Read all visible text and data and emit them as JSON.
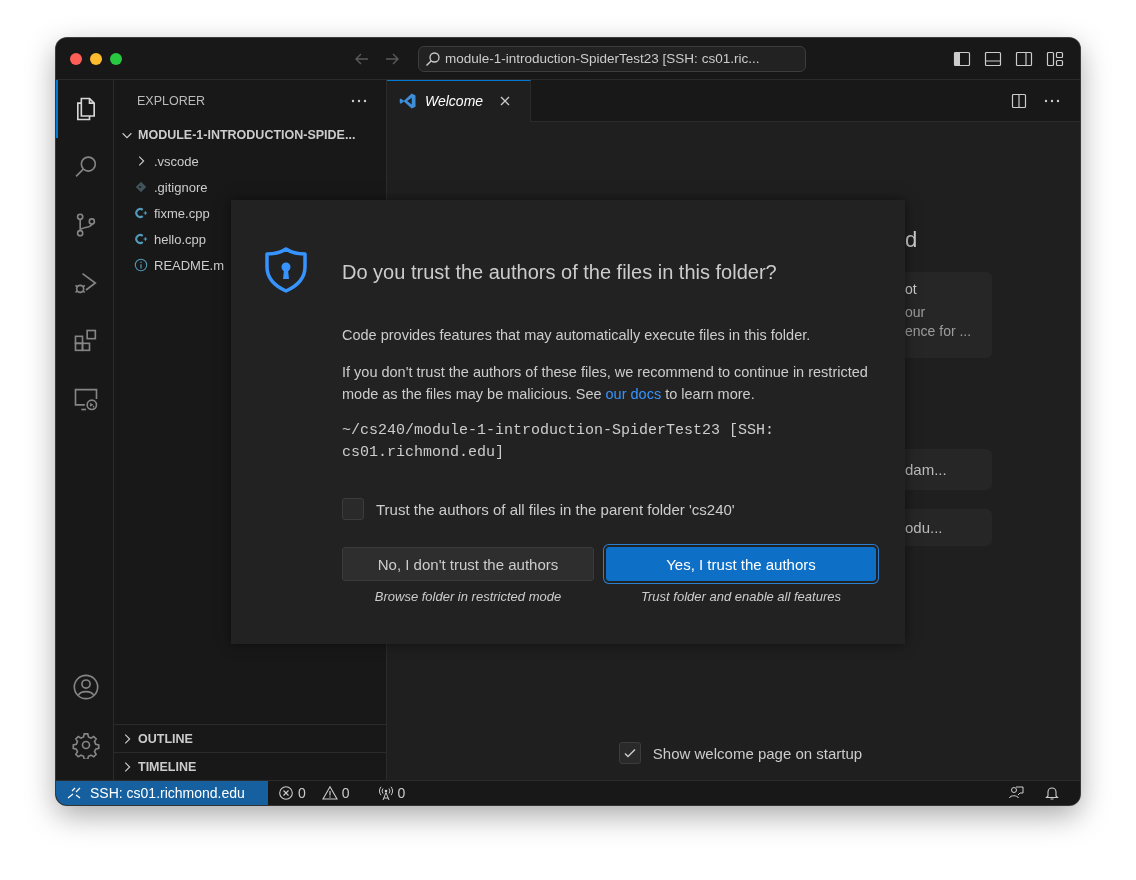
{
  "title_bar": {
    "command_center": "module-1-introduction-SpiderTest23 [SSH: cs01.ric..."
  },
  "activity_bar": {
    "items": [
      {
        "kind": "explorer",
        "selected": true
      },
      {
        "kind": "search",
        "selected": false
      },
      {
        "kind": "source-control",
        "selected": false
      },
      {
        "kind": "run-debug",
        "selected": false
      },
      {
        "kind": "extensions",
        "selected": false
      },
      {
        "kind": "remote-explorer",
        "selected": false
      }
    ],
    "bottom_items": [
      {
        "kind": "accounts"
      },
      {
        "kind": "manage"
      }
    ]
  },
  "sidebar": {
    "title": "EXPLORER",
    "folder": {
      "name": "MODULE-1-INTRODUCTION-SPIDE...",
      "expanded": true,
      "children": [
        {
          "name": ".vscode",
          "kind": "folder",
          "expanded": false
        },
        {
          "name": ".gitignore",
          "kind": "git"
        },
        {
          "name": "fixme.cpp",
          "kind": "cpp"
        },
        {
          "name": "hello.cpp",
          "kind": "cpp"
        },
        {
          "name": "README.m",
          "kind": "info"
        }
      ]
    },
    "sections": [
      {
        "name": "OUTLINE",
        "expanded": false
      },
      {
        "name": "TIMELINE",
        "expanded": false
      }
    ]
  },
  "editor": {
    "tabs": [
      {
        "label": "Welcome",
        "selected": true
      }
    ],
    "welcome": {
      "heading": "d",
      "cards": [
        {
          "lines": [
            "ot",
            "our",
            "ence for ..."
          ]
        },
        {
          "lines": [
            "dam..."
          ]
        },
        {
          "lines": [
            "odu..."
          ]
        }
      ],
      "startup_option": {
        "label": "Show welcome page on startup",
        "checked": true
      }
    }
  },
  "dialog": {
    "title": "Do you trust the authors of the files in this folder?",
    "intro": "Code provides features that may automatically execute files in this folder.",
    "warning": {
      "before": "If you don't trust the authors of these files, we recommend to continue in restricted mode as the files may be malicious. See ",
      "link": "our docs",
      "after": " to learn more."
    },
    "path": "~/cs240/module-1-introduction-SpiderTest23 [SSH: cs01.richmond.edu]",
    "parent_option": {
      "label": "Trust the authors of all files in the parent folder 'cs240'",
      "checked": false
    },
    "buttons": [
      {
        "label": "No, I don't trust the authors",
        "caption": "Browse folder in restricted mode",
        "kind": "secondary"
      },
      {
        "label": "Yes, I trust the authors",
        "caption": "Trust folder and enable all features",
        "kind": "primary"
      }
    ]
  },
  "status_bar": {
    "remote": "SSH: cs01.richmond.edu",
    "errors": "0",
    "warnings": "0",
    "ports": "0"
  }
}
